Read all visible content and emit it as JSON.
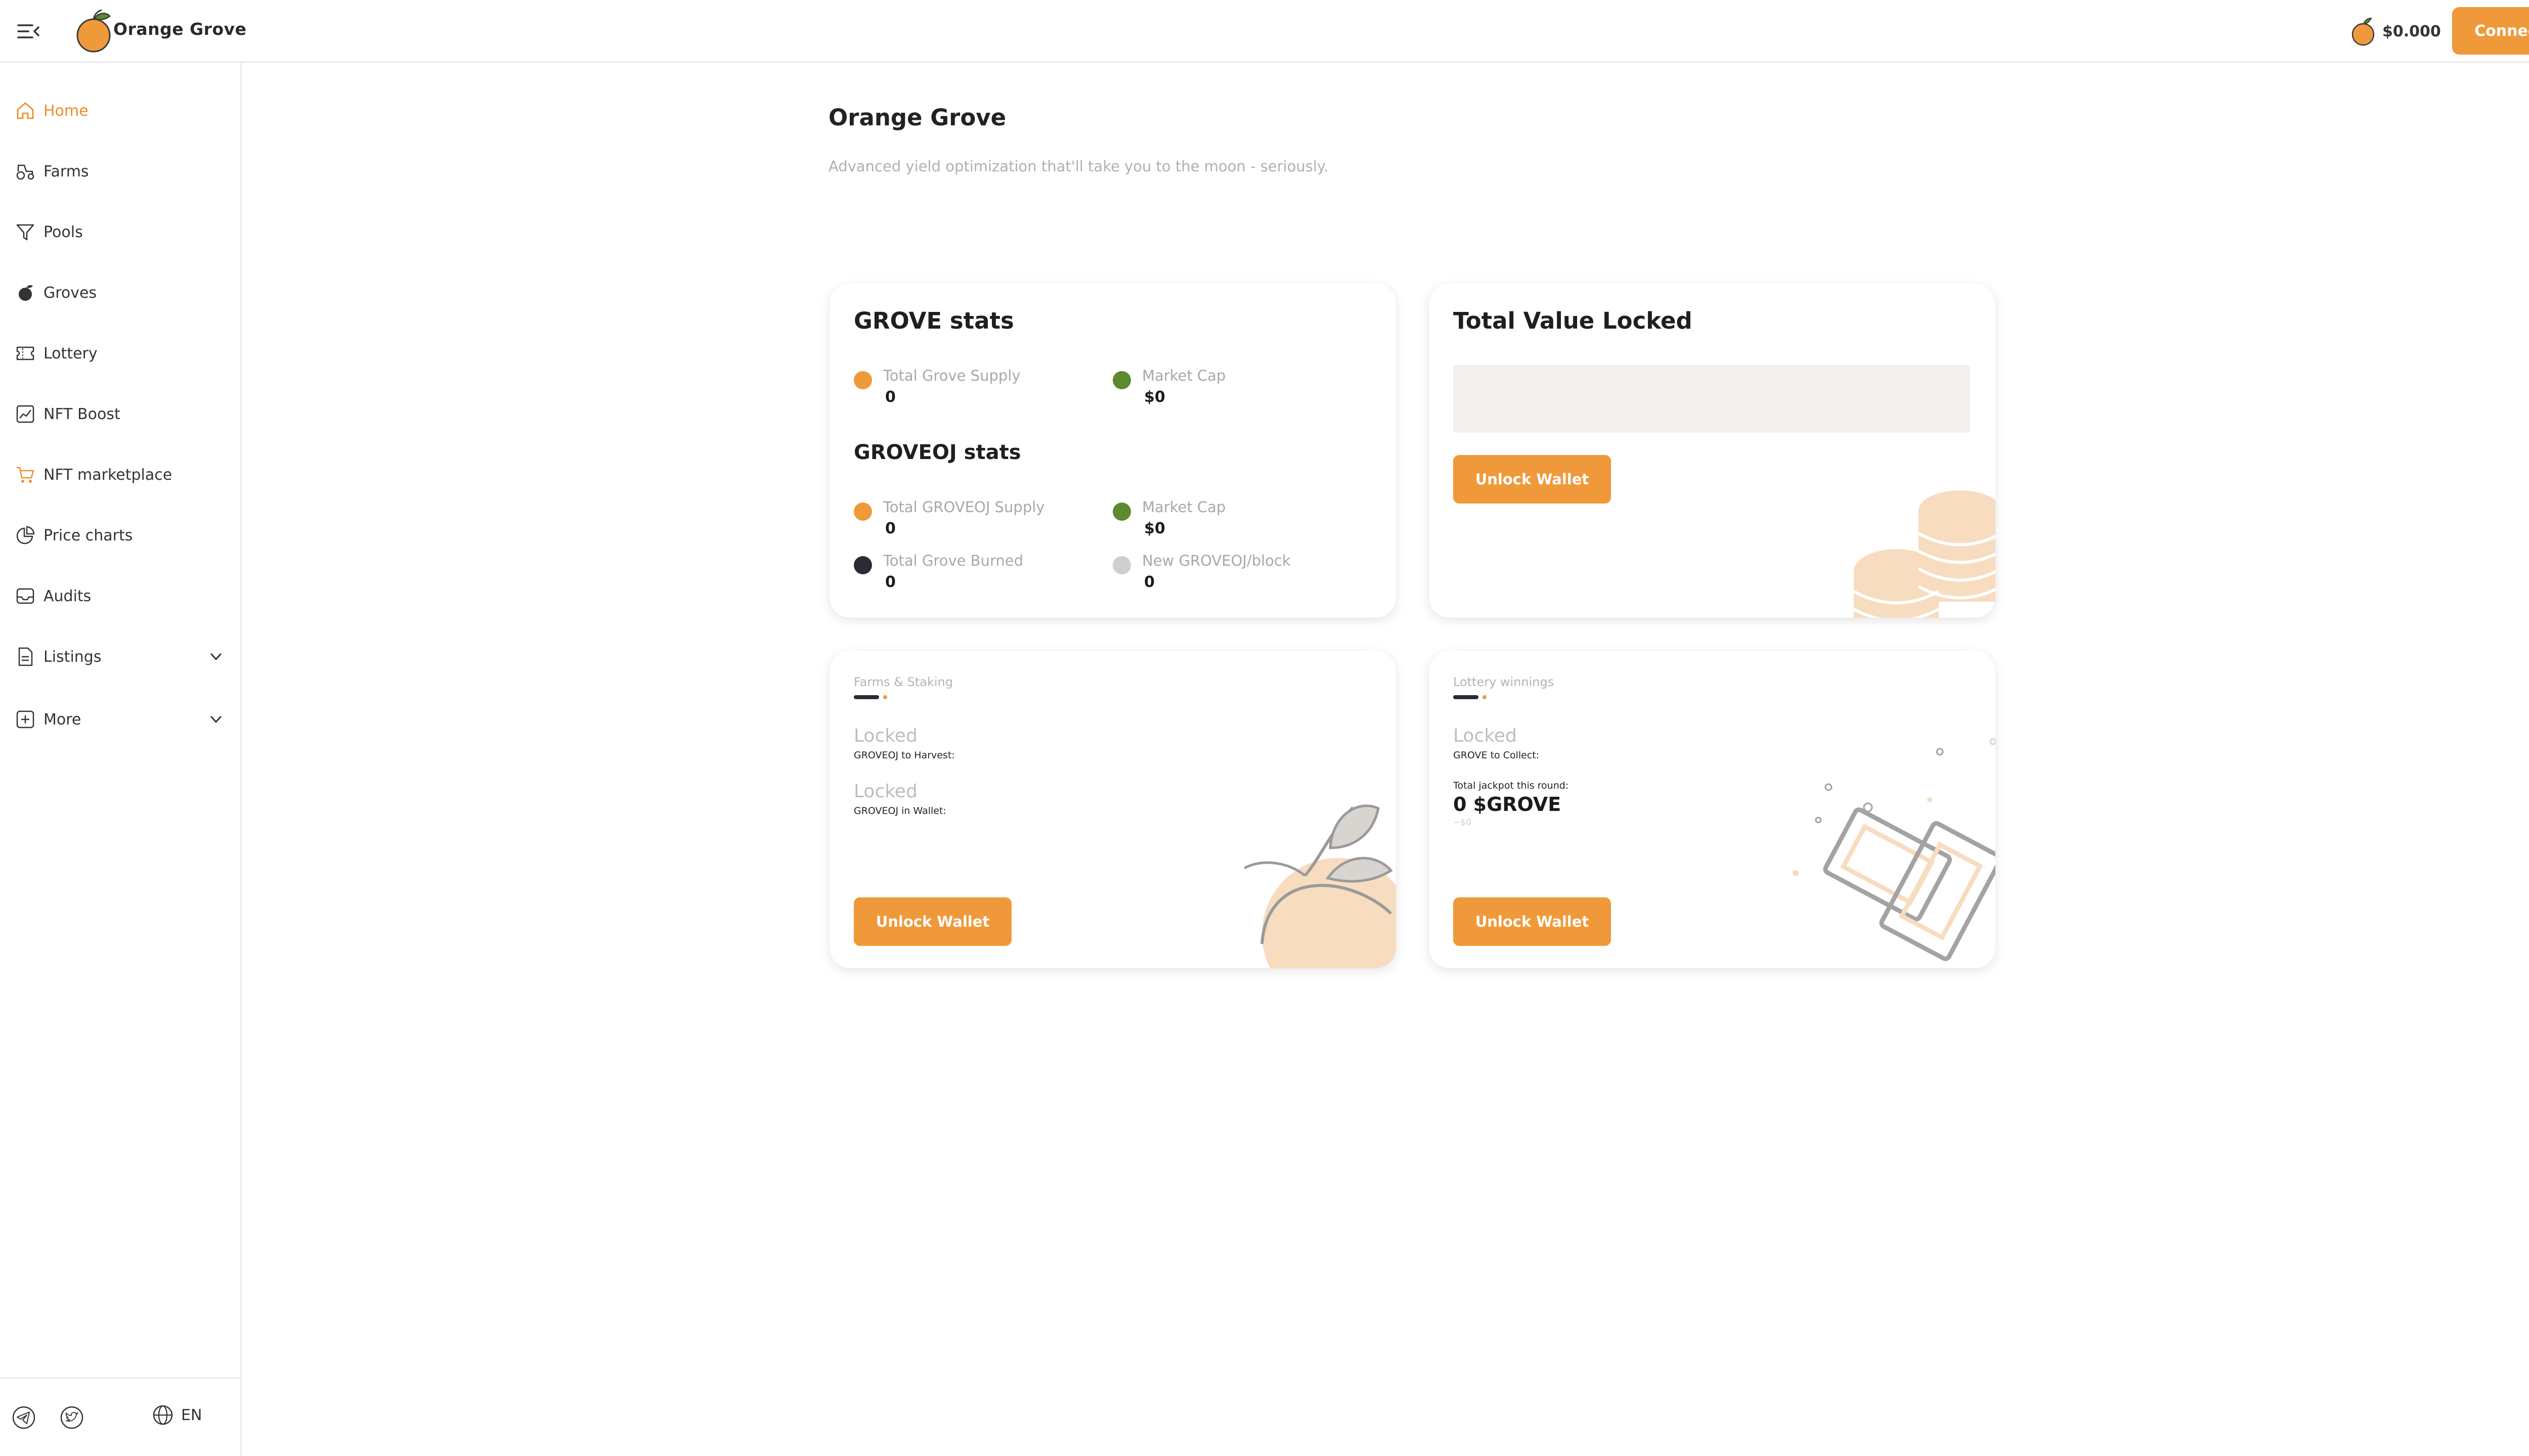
{
  "header": {
    "brand": "Orange Grove",
    "price": "$0.000",
    "connect_label": "Connect"
  },
  "sidebar": {
    "items": [
      {
        "label": "Home",
        "icon": "home-icon",
        "active": true
      },
      {
        "label": "Farms",
        "icon": "tractor-icon"
      },
      {
        "label": "Pools",
        "icon": "funnel-icon"
      },
      {
        "label": "Groves",
        "icon": "orange-fruit-icon"
      },
      {
        "label": "Lottery",
        "icon": "ticket-icon"
      },
      {
        "label": "NFT Boost",
        "icon": "trend-chart-icon"
      },
      {
        "label": "NFT marketplace",
        "icon": "cart-icon"
      },
      {
        "label": "Price charts",
        "icon": "pie-chart-icon"
      },
      {
        "label": "Audits",
        "icon": "inbox-icon"
      },
      {
        "label": "Listings",
        "icon": "document-icon",
        "expandable": true
      },
      {
        "label": "More",
        "icon": "plus-square-icon",
        "expandable": true
      }
    ],
    "footer": {
      "language": "EN"
    }
  },
  "main": {
    "title": "Orange Grove",
    "subtitle": "Advanced yield optimization that'll take you to the moon - seriously."
  },
  "grove_stats": {
    "title": "GROVE stats",
    "total_supply": {
      "label": "Total Grove Supply",
      "value": "0"
    },
    "market_cap": {
      "label": "Market Cap",
      "value": "$0"
    }
  },
  "groveoj_stats": {
    "title": "GROVEOJ stats",
    "total_supply": {
      "label": "Total GROVEOJ Supply",
      "value": "0"
    },
    "market_cap": {
      "label": "Market Cap",
      "value": "$0"
    },
    "burned": {
      "label": "Total Grove Burned",
      "value": "0"
    },
    "new_per_block": {
      "label": "New GROVEOJ/block",
      "value": "0"
    }
  },
  "tvl": {
    "title": "Total Value Locked",
    "unlock_label": "Unlock Wallet"
  },
  "farms": {
    "heading": "Farms & Staking",
    "harvest_status": "Locked",
    "harvest_label": "GROVEOJ to Harvest:",
    "wallet_status": "Locked",
    "wallet_label": "GROVEOJ in Wallet:",
    "unlock_label": "Unlock Wallet"
  },
  "lottery": {
    "heading": "Lottery winnings",
    "collect_status": "Locked",
    "collect_label": "GROVE to Collect:",
    "jackpot_label": "Total jackpot this round:",
    "jackpot_value": "0 $GROVE",
    "jackpot_usd": "~$0",
    "unlock_label": "Unlock Wallet"
  },
  "colors": {
    "accent": "#f0993a",
    "active_text": "#ef8c2a",
    "dot_orange": "#f0993a",
    "dot_green": "#5b8a2f",
    "dot_dark": "#2b2b35",
    "dot_grey": "#cfcfcf"
  }
}
